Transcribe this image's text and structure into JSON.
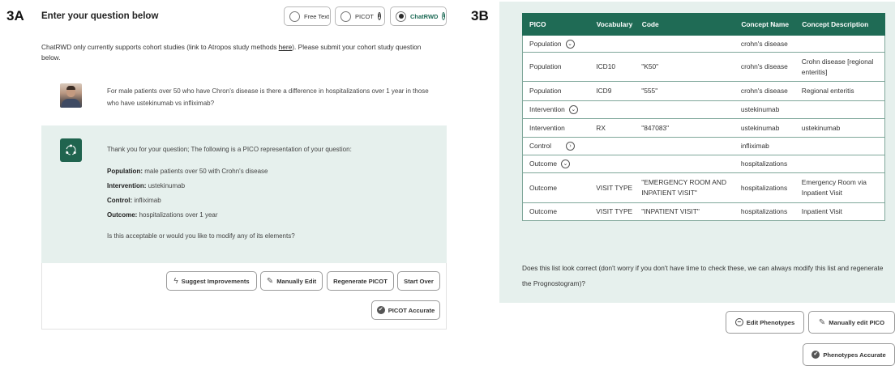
{
  "panelA": {
    "label": "3A",
    "title": "Enter your question below",
    "modes": [
      {
        "label": "Free Text",
        "selected": false,
        "info": false
      },
      {
        "label": "PICOT",
        "selected": false,
        "info": true
      },
      {
        "label": "ChatRWD",
        "selected": true,
        "info": true
      }
    ],
    "intro_before_link": "ChatRWD only currently supports cohort studies (link to Atropos study methods ",
    "intro_link": "here",
    "intro_after_link": "). Please submit your cohort study question below.",
    "user_message": "For male patients over 50 who have Chron's disease is there a difference in hospitalizations over 1 year in those who have ustekinumab vs infliximab?",
    "assistant": {
      "intro": "Thank you for your question; The following is a PICO representation of your question:",
      "population_label": "Population:",
      "population": "male patients over 50 with Crohn's disease",
      "intervention_label": "Intervention:",
      "intervention": "ustekinumab",
      "control_label": "Control:",
      "control": "infliximab",
      "outcome_label": "Outcome:",
      "outcome": "hospitalizations over 1 year",
      "question": "Is this acceptable or would you like to modify any of its elements?"
    },
    "buttons": {
      "suggest": "Suggest Improvements",
      "manual_edit": "Manually Edit",
      "regenerate": "Regenerate PICOT",
      "start_over": "Start Over",
      "accurate": "PICOT Accurate"
    }
  },
  "panelB": {
    "label": "3B",
    "columns": [
      "PICO",
      "Vocabulary",
      "Code",
      "Concept Name",
      "Concept Description"
    ],
    "rows": [
      {
        "pico": "Population",
        "expand": true,
        "vocab": "",
        "code": "",
        "name": "crohn's disease",
        "desc": ""
      },
      {
        "pico": "Population",
        "expand": false,
        "vocab": "ICD10",
        "code": "\"K50\"",
        "name": "crohn's disease",
        "desc": "Crohn disease [regional enteritis]"
      },
      {
        "pico": "Population",
        "expand": false,
        "vocab": "ICD9",
        "code": "\"555\"",
        "name": "crohn's disease",
        "desc": "Regional enteritis"
      },
      {
        "pico": "Intervention",
        "expand": true,
        "vocab": "",
        "code": "",
        "name": "ustekinumab",
        "desc": ""
      },
      {
        "pico": "Intervention",
        "expand": false,
        "vocab": "RX",
        "code": "\"847083\"",
        "name": "ustekinumab",
        "desc": "ustekinumab"
      },
      {
        "pico": "Control",
        "expand": true,
        "vocab": "",
        "code": "",
        "name": "infliximab",
        "desc": ""
      },
      {
        "pico": "Outcome",
        "expand": true,
        "vocab": "",
        "code": "",
        "name": "hospitalizations",
        "desc": ""
      },
      {
        "pico": "Outcome",
        "expand": false,
        "vocab": "VISIT TYPE",
        "code": "\"EMERGENCY ROOM AND INPATIENT VISIT\"",
        "name": "hospitalizations",
        "desc": "Emergency Room via Inpatient Visit"
      },
      {
        "pico": "Outcome",
        "expand": false,
        "vocab": "VISIT TYPE",
        "code": "\"INPATIENT VISIT\"",
        "name": "hospitalizations",
        "desc": "Inpatient Visit"
      }
    ],
    "question": "Does this list look correct (don't worry if you don't have time to check these, we can always modify this list and regenerate the Prognostogram)?",
    "buttons": {
      "edit_phenotypes": "Edit Phenotypes",
      "manual_edit_pico": "Manually edit PICO",
      "accurate": "Phenotypes Accurate"
    }
  },
  "colors": {
    "accent": "#1f6b55",
    "panel_bg": "#e6f0ed"
  }
}
